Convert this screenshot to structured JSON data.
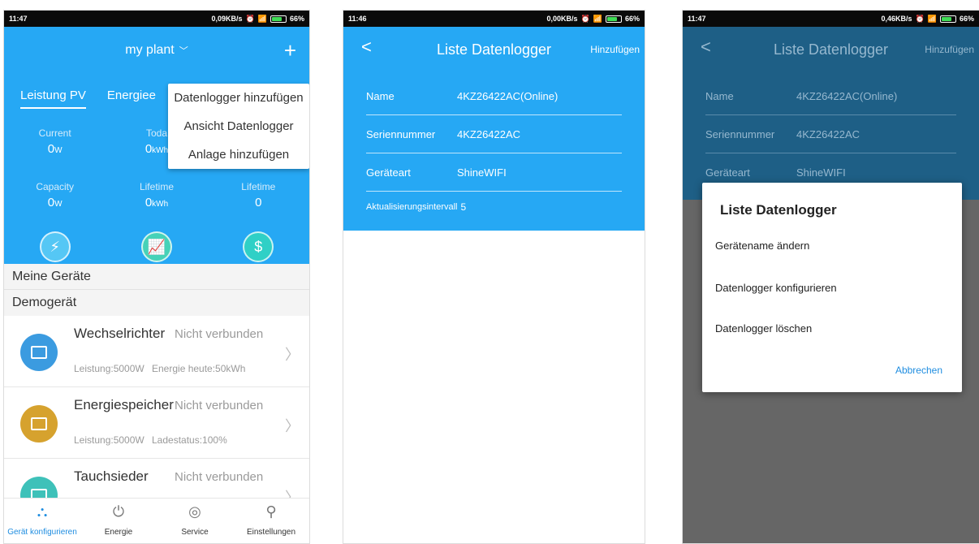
{
  "panel1": {
    "status": {
      "time": "11:47",
      "speed": "0,09KB/s",
      "battery": "66%"
    },
    "plant_title": "my plant",
    "tabs": [
      "Leistung PV",
      "Energiee"
    ],
    "grid_row1": [
      {
        "label": "Current",
        "value": "0",
        "unit": "W"
      },
      {
        "label": "Toda",
        "value": "0",
        "unit": "kWh"
      },
      {
        "label": "",
        "value": "",
        "unit": ""
      }
    ],
    "grid_row2": [
      {
        "label": "Capacity",
        "value": "0",
        "unit": "W"
      },
      {
        "label": "Lifetime",
        "value": "0",
        "unit": "kWh"
      },
      {
        "label": "Lifetime",
        "value": "0",
        "unit": ""
      }
    ],
    "dropdown": [
      "Datenlogger hinzufügen",
      "Ansicht Datenlogger",
      "Anlage hinzufügen"
    ],
    "section_my_devices": "Meine Geräte",
    "section_demo": "Demogerät",
    "devices": [
      {
        "name": "Wechselrichter",
        "status": "Nicht verbunden",
        "sub1": "Leistung:5000W",
        "sub2": "Energie heute:50kWh"
      },
      {
        "name": "Energiespeicher",
        "status": "Nicht verbunden",
        "sub1": "Leistung:5000W",
        "sub2": "Ladestatus:100%"
      },
      {
        "name": "Tauchsieder",
        "status": "Nicht verbunden",
        "sub1": "",
        "sub2": ""
      }
    ],
    "tabbar": [
      "Gerät konfigurieren",
      "Energie",
      "Service",
      "Einstellungen"
    ]
  },
  "panel2": {
    "status": {
      "time": "11:46",
      "speed": "0,00KB/s",
      "battery": "66%"
    },
    "title": "Liste Datenlogger",
    "add": "Hinzufügen",
    "rows": [
      {
        "key": "Name",
        "value": "4KZ26422AC(Online)"
      },
      {
        "key": "Seriennummer",
        "value": "4KZ26422AC"
      },
      {
        "key": "Geräteart",
        "value": "ShineWIFI"
      }
    ],
    "interval_label": "Aktualisierungsintervall",
    "interval_value": "5"
  },
  "panel3": {
    "status": {
      "time": "11:47",
      "speed": "0,46KB/s",
      "battery": "66%"
    },
    "title": "Liste Datenlogger",
    "add": "Hinzufügen",
    "rows": [
      {
        "key": "Name",
        "value": "4KZ26422AC(Online)"
      },
      {
        "key": "Seriennummer",
        "value": "4KZ26422AC"
      },
      {
        "key": "Geräteart",
        "value": "ShineWIFI"
      }
    ],
    "dialog": {
      "title": "Liste Datenlogger",
      "options": [
        "Gerätename ändern",
        "Datenlogger konfigurieren",
        "Datenlogger löschen"
      ],
      "cancel": "Abbrechen"
    }
  }
}
